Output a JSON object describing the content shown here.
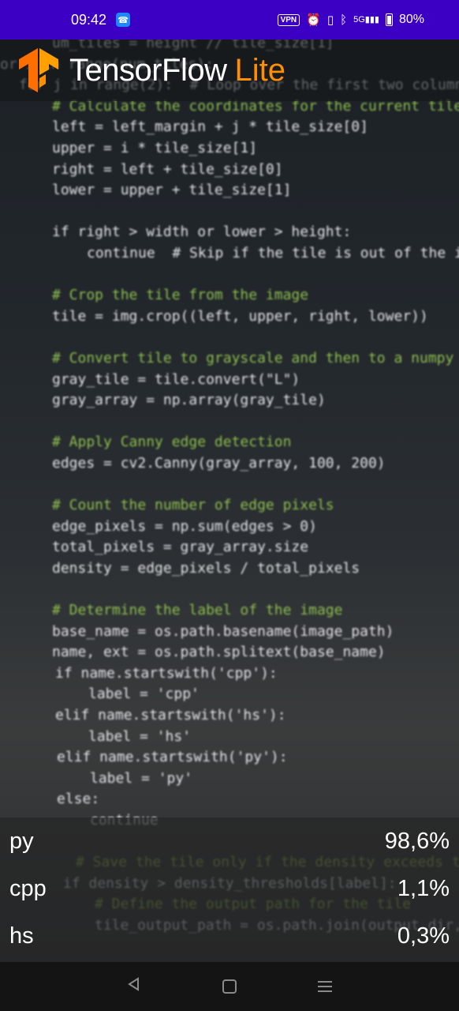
{
  "status_bar": {
    "time": "09:42",
    "vpn": "VPN",
    "network": "5G",
    "battery": "80%"
  },
  "header": {
    "brand_main": "TensorFlow",
    "brand_accent": "Lite",
    "accent_color": "#ff8f00"
  },
  "camera_code_lines": [
    "um_tiles = height // tile_size[1]",
    "or i in range(num_tiles):",
    "  for j in range(2):  # Loop over the first two columns",
    "      # Calculate the coordinates for the current tile",
    "      left = left_margin + j * tile_size[0]",
    "      upper = i * tile_size[1]",
    "      right = left + tile_size[0]",
    "      lower = upper + tile_size[1]",
    "",
    "      if right > width or lower > height:",
    "          continue  # Skip if the tile is out of the image",
    "",
    "      # Crop the tile from the image",
    "      tile = img.crop((left, upper, right, lower))",
    "",
    "      # Convert tile to grayscale and then to a numpy array",
    "      gray_tile = tile.convert(\"L\")",
    "      gray_array = np.array(gray_tile)",
    "",
    "      # Apply Canny edge detection",
    "      edges = cv2.Canny(gray_array, 100, 200)",
    "",
    "      # Count the number of edge pixels",
    "      edge_pixels = np.sum(edges > 0)",
    "      total_pixels = gray_array.size",
    "      density = edge_pixels / total_pixels",
    "",
    "      # Determine the label of the image",
    "      base_name = os.path.basename(image_path)",
    "      name, ext = os.path.splitext(base_name)",
    "      if name.startswith('cpp'):",
    "          label = 'cpp'",
    "      elif name.startswith('hs'):",
    "          label = 'hs'",
    "      elif name.startswith('py'):",
    "          label = 'py'",
    "      else:",
    "          continue",
    "",
    "      # Save the tile only if the density exceeds the per",
    "      if density > density_thresholds[label]:",
    "          # Define the output path for the tile",
    "          tile_output_path = os.path.join(output_dir, f\""
  ],
  "results": [
    {
      "label": "py",
      "score": "98,6%"
    },
    {
      "label": "cpp",
      "score": "1,1%"
    },
    {
      "label": "hs",
      "score": "0,3%"
    }
  ]
}
